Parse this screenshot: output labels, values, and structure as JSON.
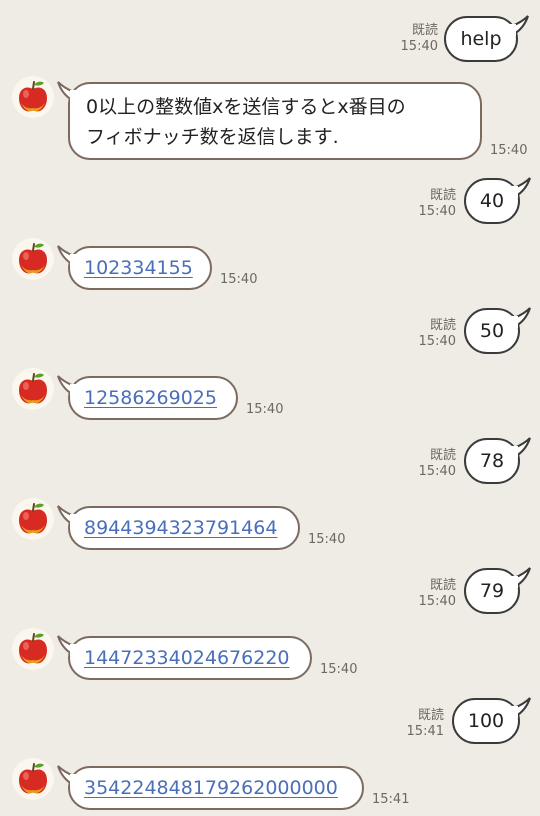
{
  "read_label": "既読",
  "messages": [
    {
      "type": "out",
      "text": "help",
      "read": "既読",
      "time": "15:40"
    },
    {
      "type": "in",
      "line1": "0以上の整数値xを送信するとx番目の",
      "line2": "フィボナッチ数を返信します.",
      "time": "15:40"
    },
    {
      "type": "out",
      "text": "40",
      "read": "既読",
      "time": "15:40"
    },
    {
      "type": "in",
      "text": "102334155",
      "time": "15:40"
    },
    {
      "type": "out",
      "text": "50",
      "read": "既読",
      "time": "15:40"
    },
    {
      "type": "in",
      "text": "12586269025",
      "time": "15:40"
    },
    {
      "type": "out",
      "text": "78",
      "read": "既読",
      "time": "15:40"
    },
    {
      "type": "in",
      "text": "8944394323791464",
      "time": "15:40"
    },
    {
      "type": "out",
      "text": "79",
      "read": "既読",
      "time": "15:40"
    },
    {
      "type": "in",
      "text": "14472334024676220",
      "time": "15:40"
    },
    {
      "type": "out",
      "text": "100",
      "read": "既読",
      "time": "15:41"
    },
    {
      "type": "in",
      "text": "354224848179262000000",
      "time": "15:41"
    }
  ],
  "colors": {
    "background": "#efebe5",
    "outgoing_border": "#3b3b3b",
    "incoming_border": "#7d6a5e",
    "link": "#4a6fba",
    "meta_text": "#6e6861"
  },
  "avatar_icon": "apple-icon"
}
